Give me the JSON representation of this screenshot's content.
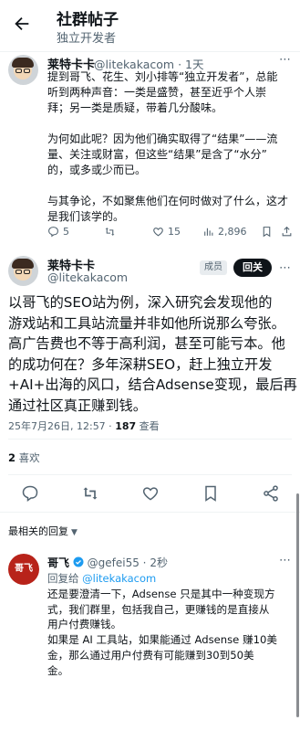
{
  "header": {
    "title": "社群帖子",
    "subtitle": "独立开发者"
  },
  "first_post": {
    "name": "莱特卡卡",
    "handle_time": "@litekakacom · 1天",
    "lines": [
      "提到哥飞、花生、刘小排等“独立开发者”，总能",
      "听到两种声音：一类是盛赞，甚至近乎个人崇",
      "拜；另一类是质疑，带着几分酸味。",
      "",
      "为何如此呢？因为他们确实取得了“结果”——流",
      "量、关注或财富，但这些“结果”是含了“水分”",
      "的，或多或少而已。",
      "",
      "与其争论，不如聚焦他们在何时做对了什么，这才",
      "是我们该学的。"
    ],
    "stats": {
      "replies": "5",
      "likes": "15",
      "views": "2,896"
    }
  },
  "focus_post": {
    "name": "莱特卡卡",
    "handle": "@litekakacom",
    "badge": "成员",
    "follow_label": "回关",
    "text_lines": [
      "以哥飞的SEO站为例，深入研究会发现他的",
      "游戏站和工具站流量并非如他所说那么夸张。",
      "高广告费也不等于高利润，甚至可能亏本。他",
      "的成功何在？多年深耕SEO，赶上独立开发",
      "+AI+出海的风口，结合Adsense变现，最后再",
      "通过社区真正赚到钱。"
    ],
    "timestamp": "25年7月26日, 12:57 · ",
    "views_count": "187",
    "views_label": " 查看",
    "likes_count": "2",
    "likes_label": " 喜欢"
  },
  "replies_section": {
    "sort_label": "最相关的回复",
    "reply": {
      "avatar_text": "哥飞",
      "name": "哥飞",
      "handle_time": " @gefei55 · 2秒",
      "reply_to_prefix": "回复给 ",
      "reply_to_handle": "@litekakacom",
      "lines": [
        "还是要澄清一下，Adsense 只是其中一种变现方",
        "式，我们群里，包括我自己，更赚钱的是直接从",
        "用户付费赚钱。",
        "如果是 AI 工具站，如果能通过 Adsense 赚10美",
        "金，那么通过用户付费有可能赚到30到50美",
        "金。"
      ]
    }
  },
  "colors": {
    "accent": "#1d9bf0",
    "text": "#0f1419",
    "muted": "#536471",
    "divider": "#eff3f4"
  }
}
